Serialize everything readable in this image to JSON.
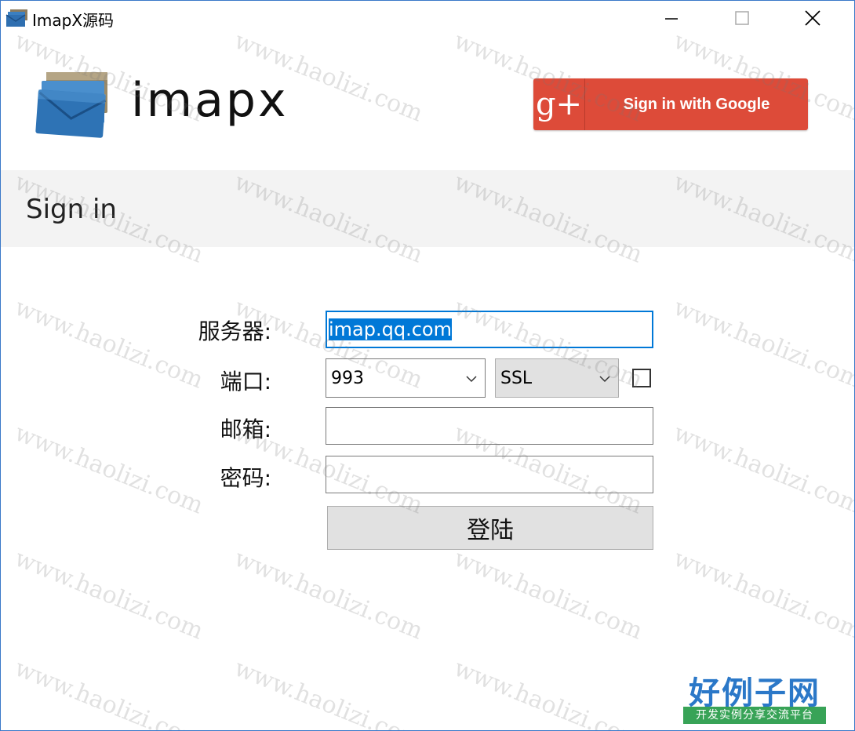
{
  "window": {
    "title": "ImapX源码"
  },
  "header": {
    "logo_text": "imapx",
    "google_glyph": "g+",
    "google_label": "Sign in with Google",
    "google_color": "#dd4b39"
  },
  "band": {
    "title": "Sign in"
  },
  "form": {
    "server_label": "服务器:",
    "server_value": "imap.qq.com",
    "port_label": "端口:",
    "port_value": "993",
    "security_value": "SSL",
    "ssl_checked": false,
    "mail_label": "邮箱:",
    "mail_value": "",
    "password_label": "密码:",
    "password_value": "",
    "login_label": "登陆"
  },
  "watermark": {
    "text": "www.haolizi.com"
  },
  "badge": {
    "title": "好例子网",
    "subtitle": "开发实例分享交流平台"
  },
  "colors": {
    "accent": "#0078d7",
    "band_bg": "#f3f3f3",
    "badge_blue": "#2b78c8",
    "badge_green": "#38a357"
  }
}
